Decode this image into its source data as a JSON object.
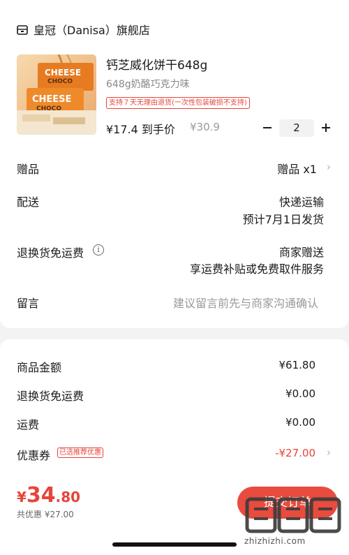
{
  "store": {
    "icon": "store-icon",
    "name": "皇冠（Danisa）旗舰店"
  },
  "product": {
    "title": "钙芝威化饼干648g",
    "spec": "648g奶酪巧克力味",
    "return_badge": "支持７天无理由退货(一次性包装破损不支持)",
    "price": "¥17.4 到手价",
    "original_price": "¥30.9",
    "quantity": "2",
    "image_text": {
      "line1": "CHEESE",
      "line2": "CHOCO"
    }
  },
  "rows": {
    "gift_label": "赠品",
    "gift_value": "赠品 x1",
    "delivery_label": "配送",
    "delivery_method": "快递运输",
    "delivery_date": "预计7月1日发货",
    "return_shipping_label": "退换货免运费",
    "return_shipping_value": "商家赠送",
    "return_shipping_desc": "享运费补贴或免费取件服务",
    "remark_label": "留言",
    "remark_placeholder": "建议留言前先与商家沟通确认"
  },
  "summary": {
    "goods_amount_label": "商品金额",
    "goods_amount_value": "¥61.80",
    "return_fee_label": "退换货免运费",
    "return_fee_value": "¥0.00",
    "shipping_label": "运费",
    "shipping_value": "¥0.00",
    "coupon_label": "优惠券",
    "coupon_tag": "已选推荐优惠",
    "coupon_value": "-¥27.00"
  },
  "footer": {
    "total_currency": "¥",
    "total_int": "34",
    "total_dec": ".80",
    "total_discount": "共优惠 ¥27.00",
    "submit_label": "提交订单"
  },
  "watermark": {
    "logo": "值得买",
    "text": "zhizhizhi.com"
  },
  "colors": {
    "accent": "#e6453a",
    "button": "#e94b3e"
  }
}
